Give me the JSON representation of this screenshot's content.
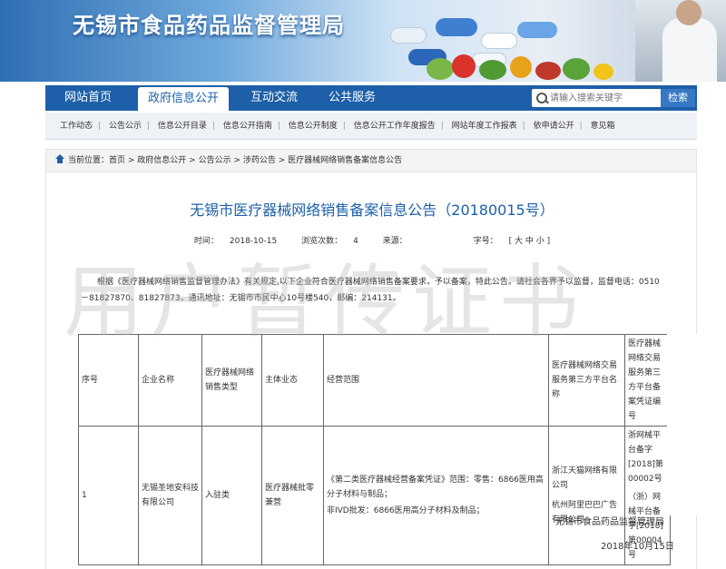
{
  "site": {
    "title": "无锡市食品药品监督管理局"
  },
  "nav": {
    "tabs": [
      "网站首页",
      "政府信息公开",
      "互动交流",
      "公共服务"
    ],
    "active_index": 1,
    "search_placeholder": "请输入搜索关键字",
    "search_button": "检索"
  },
  "subnav": {
    "items": [
      "工作动态",
      "公告公示",
      "信息公开目录",
      "信息公开指南",
      "信息公开制度",
      "信息公开工作年度报告",
      "网站年度工作报表",
      "依申请公开",
      "意见箱"
    ]
  },
  "breadcrumb": {
    "prefix": "当前位置：",
    "items": [
      "首页",
      "政府信息公开",
      "公告公示",
      "涉药公告",
      "医疗器械网络销售备案信息公告"
    ],
    "separator": " > "
  },
  "article": {
    "title": "无锡市医疗器械网络销售备案信息公告（20180015号）",
    "time_label": "时间：",
    "time": "2018-10-15",
    "views_label": "浏览次数：",
    "views": "4",
    "source_label": "来源：",
    "source": "",
    "font_label": "字号：",
    "font_sizes": "[ 大 中 小 ]",
    "paragraph": "根据《医疗器械网络销售监督管理办法》有关规定,以下企业符合医疗器械网络销售备案要求，予以备案，特此公告。请社会各界予以监督，监督电话：0510－81827870、81827873，通讯地址：无锡市市民中心10号楼540，邮编：214131。"
  },
  "watermark": "用户暂传证书",
  "table": {
    "headers": [
      "序号",
      "企业名称",
      "医疗器械网络销售类型",
      "主体业态",
      "经营范围",
      "医疗器械网络交易服务第三方平台名称",
      "医疗器械网络交易服务第三方平台备案凭证编号"
    ],
    "rows": [
      {
        "no": "1",
        "company": "无锡圣地安科技有限公司",
        "type": "入驻类",
        "business": "医疗器械批零兼营",
        "scope_1": "《第二类医疗器械经营备案凭证》范围：零售：6866医用高分子材料与制品；",
        "scope_2": "非IVD批发：6866医用高分子材料及制品；",
        "platform_1": "浙江天猫网络有限公司",
        "platform_2": "杭州阿里巴巴广告有限公司",
        "cert_1": "浙网械平台备字[2018]第00002号",
        "cert_2": "（浙）网械平台备字[2018]第00004号"
      }
    ]
  },
  "footer": {
    "org": "无锡市食品药品监督管理局",
    "date": "2018年10月15日"
  }
}
